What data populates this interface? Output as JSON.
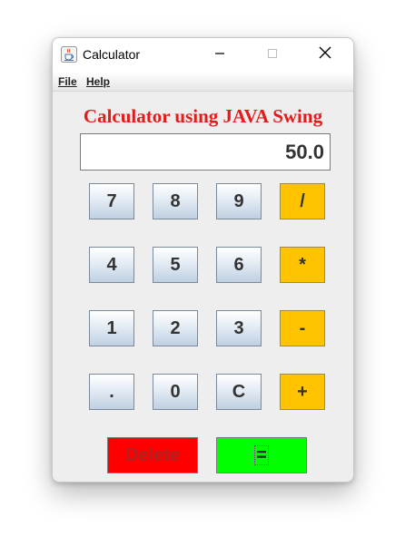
{
  "window": {
    "title": "Calculator",
    "controls": {
      "minimize": "minimize-icon",
      "maximize": "maximize-icon",
      "close": "close-icon"
    }
  },
  "menu": {
    "file": "File",
    "help": "Help"
  },
  "heading": "Calculator using JAVA Swing",
  "display": {
    "value": "50.0"
  },
  "keypad": {
    "rows": [
      [
        "7",
        "8",
        "9",
        "/"
      ],
      [
        "4",
        "5",
        "6",
        "*"
      ],
      [
        "1",
        "2",
        "3",
        "-"
      ],
      [
        ".",
        "0",
        "C",
        "+"
      ]
    ]
  },
  "actions": {
    "delete": "Delete",
    "equals": "="
  },
  "colors": {
    "heading": "#e31b1b",
    "operator_button": "#ffc300",
    "delete_button": "#ff0000",
    "equals_button": "#00ff00"
  }
}
